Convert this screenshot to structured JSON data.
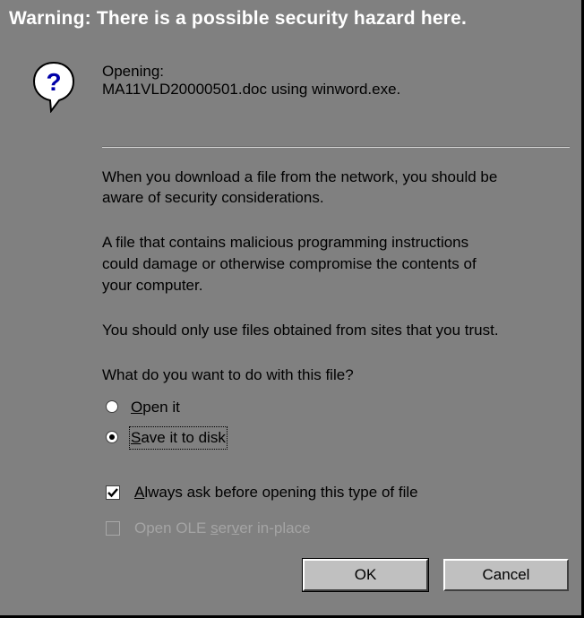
{
  "title": "Warning:  There is a possible security hazard here.",
  "icon": "question-icon",
  "opening": {
    "label": "Opening:",
    "file_line": "MA11VLD20000501.doc using winword.exe."
  },
  "body": {
    "para1_line1": "When you download a file from the network, you should be",
    "para1_line2": "aware of security considerations.",
    "para2_line1": "A file that contains malicious programming instructions",
    "para2_line2": "could damage or otherwise compromise the contents of",
    "para2_line3": "your computer.",
    "para3": "You should only use files obtained from sites that you trust.",
    "question": "What do you want to do with this file?"
  },
  "options": {
    "open_it": {
      "mnemonic": "O",
      "rest": "pen it",
      "selected": false
    },
    "save_it": {
      "mnemonic": "S",
      "rest": "ave it to disk",
      "selected": true
    }
  },
  "checkboxes": {
    "always_ask": {
      "mnemonic": "A",
      "rest": "lways ask before opening this type of file",
      "checked": true
    },
    "ole": {
      "before": "Open OLE ",
      "mnemonic": "s",
      "middle": "er",
      "mnemonic2": "v",
      "after": "er in-place",
      "checked": false,
      "enabled": false
    }
  },
  "buttons": {
    "ok": "OK",
    "cancel": "Cancel"
  },
  "colors": {
    "background": "#808080",
    "button_face": "#c0c0c0",
    "title_text": "#ffffff",
    "disabled_text": "#a4a4a4"
  }
}
